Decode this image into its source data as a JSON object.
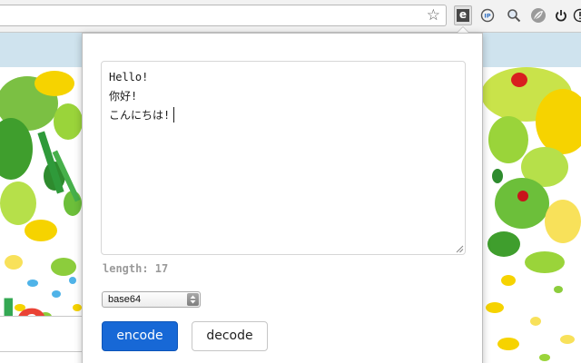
{
  "toolbar": {
    "bookmark_icon": "star-icon",
    "extensions": [
      {
        "name": "encode-extension",
        "glyph": "e",
        "active": true
      },
      {
        "name": "ip-icon",
        "glyph": "IP"
      },
      {
        "name": "search-icon"
      },
      {
        "name": "leaf-icon"
      },
      {
        "name": "power-icon"
      },
      {
        "name": "info-icon"
      }
    ]
  },
  "popup": {
    "text": {
      "line1": "Hello!",
      "line2": "你好!",
      "line3": "こんにちは!"
    },
    "length_label": "length: 17",
    "encoding": {
      "selected": "base64"
    },
    "encode_label": "encode",
    "decode_label": "decode",
    "accent_color": "#1768d6"
  },
  "page": {
    "doodle_letters": [
      "l",
      "e"
    ],
    "colors": {
      "green": "#34a853",
      "red": "#ea4335",
      "yellow": "#f6d300",
      "blue": "#4fb3e8"
    }
  }
}
